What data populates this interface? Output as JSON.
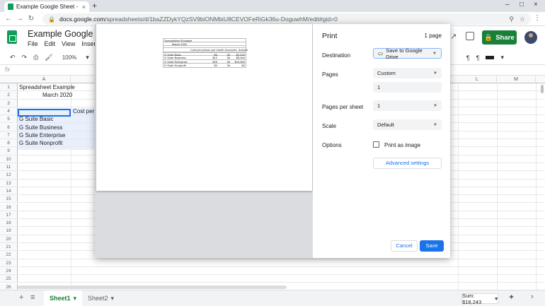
{
  "browser": {
    "tab_title": "Example Google Sheet - Google",
    "tab_close": "×",
    "new_tab": "+",
    "url_host": "docs.google.com",
    "url_path": "/spreadsheets/d/1baZZDykYQzSV9biONMbiU8CEVOFeRiGk36u-DoguwhM/edit#gid=0",
    "win_min": "–",
    "win_max": "□",
    "win_close": "×"
  },
  "sheets": {
    "title": "Example Google Sheet",
    "menu": [
      "File",
      "Edit",
      "View",
      "Insert"
    ],
    "share_label": "Share",
    "zoom": "100%",
    "currency": "$",
    "fx": "fx"
  },
  "grid": {
    "columns": [
      "A",
      "L",
      "M"
    ],
    "rows": [
      "1",
      "2",
      "3",
      "4",
      "5",
      "6",
      "7",
      "8",
      "9",
      "10",
      "11",
      "12",
      "13",
      "14",
      "15",
      "16",
      "17",
      "18",
      "19",
      "20",
      "21",
      "22",
      "23",
      "24",
      "25",
      "26"
    ],
    "cells": {
      "a1": "Spreadsheet Example",
      "a2": "March 2020",
      "b4": "Cost per p",
      "a5": "G Suite Basic",
      "a6": "G Suite Business",
      "a7": "G Suite Enterprise",
      "a8": "G Suite Nonprofit"
    }
  },
  "preview": {
    "title": "Spreadsheet Example",
    "date": "March 2020",
    "headers": [
      "Cost per person per month",
      "Accounts",
      "Annual"
    ],
    "rows": [
      {
        "name": "G Suite Basic",
        "cost": "$6",
        "accounts": "36",
        "annual": "$2,620"
      },
      {
        "name": "G Suite Business",
        "cost": "$12",
        "accounts": "36",
        "annual": "$5,640"
      },
      {
        "name": "G Suite Enterprise",
        "cost": "$25",
        "accounts": "36",
        "annual": "$10,800"
      },
      {
        "name": "G Suite Nonprofit",
        "cost": "$0",
        "accounts": "36",
        "annual": "$0"
      }
    ]
  },
  "print": {
    "title": "Print",
    "page_count": "1 page",
    "destination_label": "Destination",
    "destination_value": "Save to Google Drive",
    "pages_label": "Pages",
    "pages_value": "Custom",
    "pages_input": "1",
    "pps_label": "Pages per sheet",
    "pps_value": "1",
    "scale_label": "Scale",
    "scale_value": "Default",
    "options_label": "Options",
    "print_as_image": "Print as image",
    "advanced": "Advanced settings",
    "cancel": "Cancel",
    "save": "Save"
  },
  "bottom": {
    "add": "+",
    "list": "≡",
    "sheet1": "Sheet1",
    "sheet2": "Sheet2",
    "sum": "Sum: $18,243"
  },
  "colors": {
    "accent": "#1a73e8",
    "share": "#188038"
  }
}
